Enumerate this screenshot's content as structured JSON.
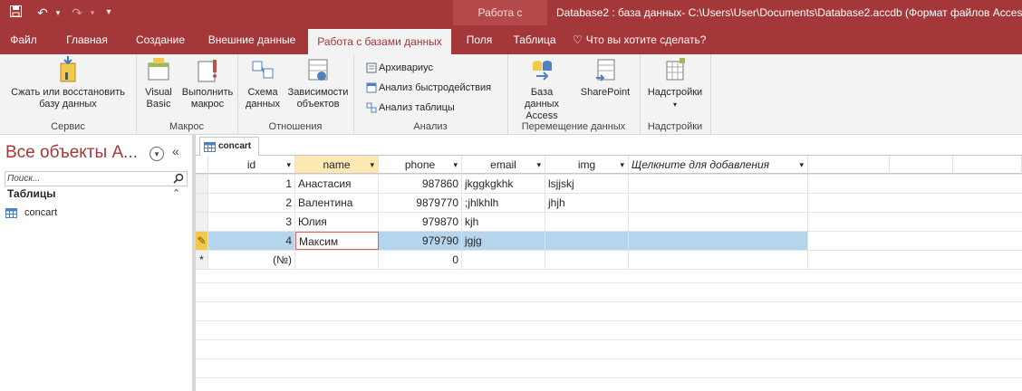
{
  "titlebar": {
    "save_icon": "save-icon",
    "undo_icon": "undo-icon",
    "redo_icon": "redo-icon",
    "customize_icon": "customize-icon",
    "context_title": "Работа с таблицами",
    "doc_title": "Database2 : база данных- C:\\Users\\User\\Documents\\Database2.accdb (Формат файлов Acces"
  },
  "tabs": [
    {
      "label": "Файл"
    },
    {
      "label": "Главная"
    },
    {
      "label": "Создание"
    },
    {
      "label": "Внешние данные"
    },
    {
      "label": "Работа с базами данных"
    },
    {
      "label": "Поля"
    },
    {
      "label": "Таблица"
    },
    {
      "label": "Что вы хотите сделать?"
    }
  ],
  "ribbon": {
    "compact_label": "Сжать или восстановить",
    "compact_label2": "базу данных",
    "service_label": "Сервис",
    "vb_label": "Visual",
    "vb_label2": "Basic",
    "run_macro_label": "Выполнить",
    "run_macro_label2": "макрос",
    "macro_label": "Макрос",
    "schema_label": "Схема",
    "schema_label2": "данных",
    "deps_label": "Зависимости",
    "deps_label2": "объектов",
    "relations_label": "Отношения",
    "archiver_label": "Архивариус",
    "perf_label": "Анализ быстродействия",
    "table_analysis_label": "Анализ таблицы",
    "analysis_label": "Анализ",
    "access_db_label": "База данных",
    "access_db_label2": "Access",
    "sharepoint_label": "SharePoint",
    "move_data_label": "Перемещение данных",
    "addins_btn_label": "Надстройки",
    "addins_label": "Надстройки"
  },
  "nav": {
    "title": "Все объекты А...",
    "search_placeholder": "Поиск...",
    "section": "Таблицы",
    "item": "concart"
  },
  "doc_tab": "concart",
  "table": {
    "columns": [
      "id",
      "name",
      "phone",
      "email",
      "img",
      "Щелкните для добавления"
    ],
    "rows": [
      {
        "id": "1",
        "name": "Анастасия",
        "phone": "987860",
        "email": "jkggkgkhk",
        "img": "lsjjskj"
      },
      {
        "id": "2",
        "name": "Валентина",
        "phone": "9879770",
        "email": ";jhlkhlh",
        "img": "jhjh"
      },
      {
        "id": "3",
        "name": "Юлия",
        "phone": "979870",
        "email": "kjh",
        "img": ""
      },
      {
        "id": "4",
        "name": "Максим",
        "phone": "979790",
        "email": "jgjg",
        "img": ""
      }
    ],
    "new_row_id": "(№)",
    "new_row_phone": "0",
    "new_row_marker": "*",
    "edit_marker": "✎"
  }
}
